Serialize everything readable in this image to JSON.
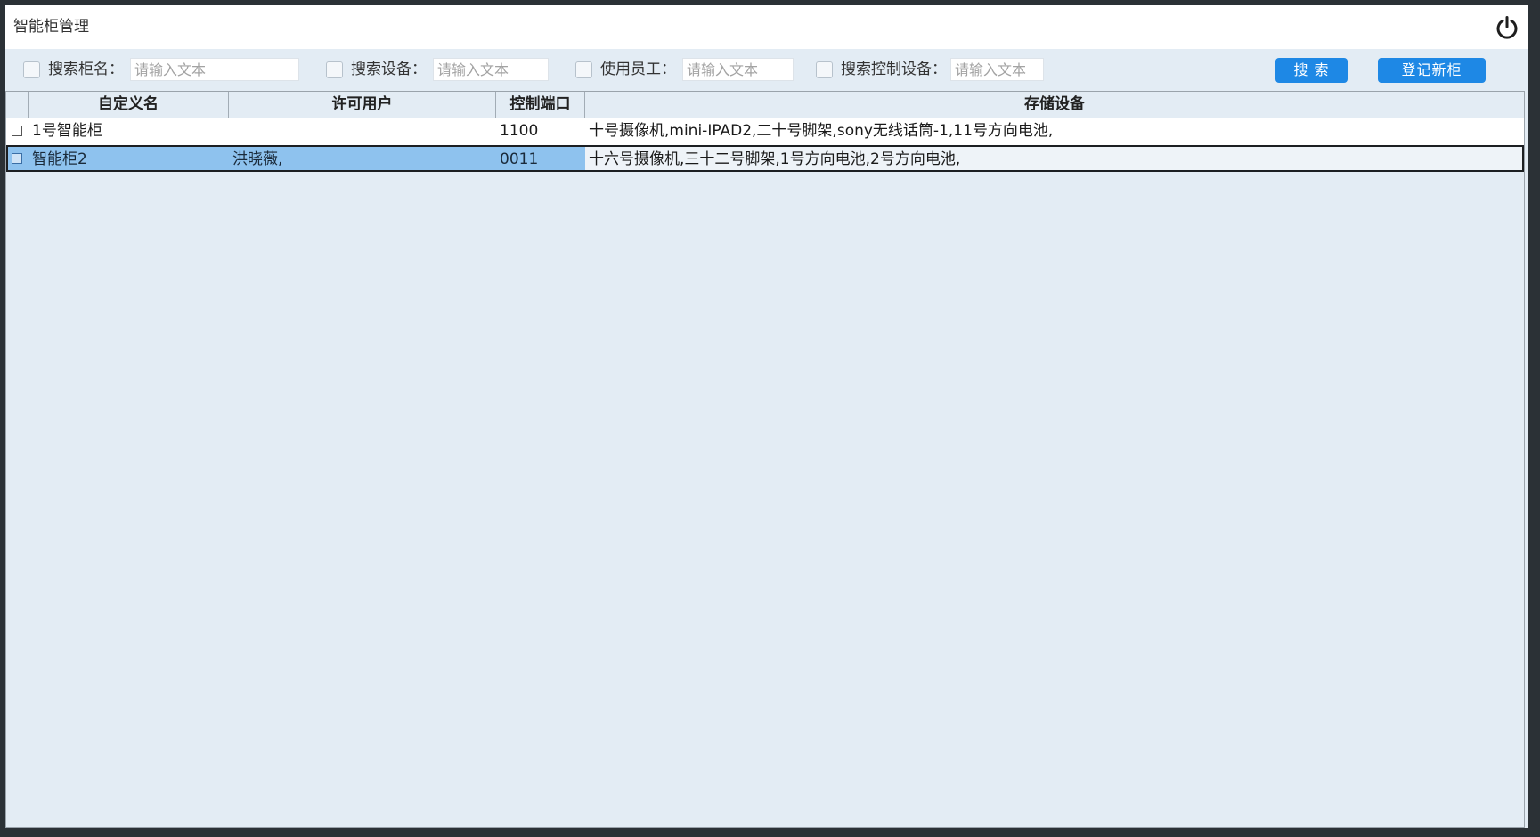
{
  "window": {
    "title": "智能柜管理",
    "power_icon": "power-icon"
  },
  "toolbar": {
    "filters": [
      {
        "label": "搜索柜名：",
        "placeholder": "请输入文本",
        "checked": false
      },
      {
        "label": "搜索设备：",
        "placeholder": "请输入文本",
        "checked": false
      },
      {
        "label": "使用员工：",
        "placeholder": "请输入文本",
        "checked": false
      },
      {
        "label": "搜索控制设备：",
        "placeholder": "请输入文本",
        "checked": false
      }
    ],
    "search_label": "搜 索",
    "register_label": "登记新柜"
  },
  "table": {
    "columns": [
      "自定义名",
      "许可用户",
      "控制端口",
      "存储设备"
    ],
    "rows": [
      {
        "name": "1号智能柜",
        "users": "",
        "port": "1100",
        "devices": "十号摄像机,mini-IPAD2,二十号脚架,sony无线话筒-1,11号方向电池,",
        "selected": false
      },
      {
        "name": "智能柜2",
        "users": "洪晓薇,",
        "port": "0011",
        "devices": "十六号摄像机,三十二号脚架,1号方向电池,2号方向电池,",
        "selected": true
      }
    ]
  },
  "colors": {
    "accent": "#1e88e5",
    "selection": "#8ec2ee",
    "background": "#e3ecf4"
  }
}
